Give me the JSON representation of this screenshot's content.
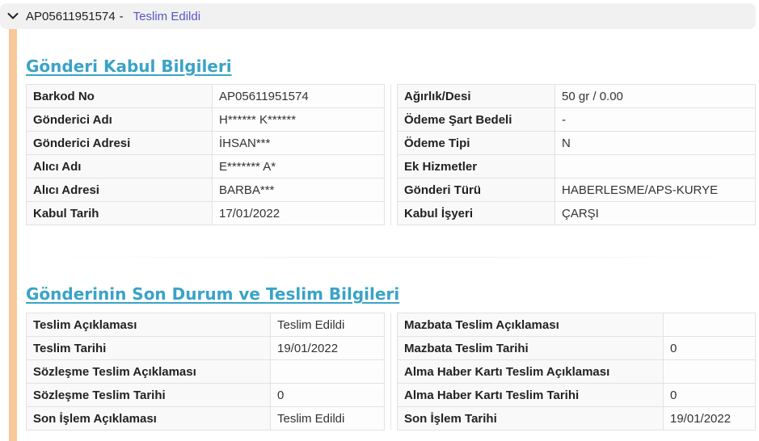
{
  "header": {
    "code": "AP05611951574",
    "separator": "-",
    "status": "Teslim Edildi",
    "status_color": "#5a55c9",
    "toggle_icon": "chevron-down-icon"
  },
  "accent_color": "#f7c998",
  "title_color": "#3aa3c6",
  "acceptance": {
    "title": "Gönderi Kabul Bilgileri",
    "left_rows": [
      {
        "label": "Barkod No",
        "value": "AP05611951574"
      },
      {
        "label": "Gönderici Adı",
        "value": "H****** K******"
      },
      {
        "label": "Gönderici Adresi",
        "value": "İHSAN***"
      },
      {
        "label": "Alıcı Adı",
        "value": "E******* A*"
      },
      {
        "label": "Alıcı Adresi",
        "value": "BARBA***"
      },
      {
        "label": "Kabul Tarih",
        "value": "17/01/2022"
      }
    ],
    "right_rows": [
      {
        "label": "Ağırlık/Desi",
        "value": "50 gr / 0.00"
      },
      {
        "label": "Ödeme Şart Bedeli",
        "value": "-"
      },
      {
        "label": "Ödeme Tipi",
        "value": "N"
      },
      {
        "label": "Ek Hizmetler",
        "value": ""
      },
      {
        "label": "Gönderi Türü",
        "value": "HABERLESME/APS-KURYE"
      },
      {
        "label": "Kabul İşyeri",
        "value": "ÇARŞI"
      }
    ]
  },
  "delivery": {
    "title": "Gönderinin Son Durum ve Teslim Bilgileri",
    "left_rows": [
      {
        "label": "Teslim Açıklaması",
        "value": "Teslim Edildi"
      },
      {
        "label": "Teslim Tarihi",
        "value": "19/01/2022"
      },
      {
        "label": "Sözleşme Teslim Açıklaması",
        "value": ""
      },
      {
        "label": "Sözleşme Teslim Tarihi",
        "value": "0"
      },
      {
        "label": "Son İşlem Açıklaması",
        "value": "Teslim Edildi"
      }
    ],
    "right_rows": [
      {
        "label": "Mazbata Teslim Açıklaması",
        "value": ""
      },
      {
        "label": "Mazbata Teslim Tarihi",
        "value": "0"
      },
      {
        "label": "Alma Haber Kartı Teslim Açıklaması",
        "value": ""
      },
      {
        "label": "Alma Haber Kartı Teslim Tarihi",
        "value": "0"
      },
      {
        "label": "Son İşlem Tarihi",
        "value": "19/01/2022"
      }
    ]
  }
}
